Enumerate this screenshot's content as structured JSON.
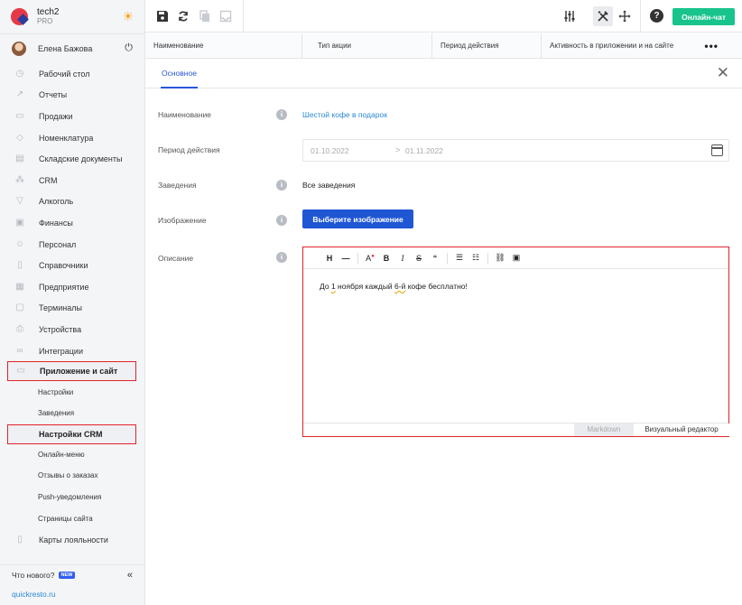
{
  "app": {
    "name": "tech2",
    "plan": "PRO"
  },
  "user": {
    "name": "Елена Бажова"
  },
  "sidebar": {
    "items": [
      {
        "label": "Рабочий стол",
        "icon": "dashboard-icon"
      },
      {
        "label": "Отчеты",
        "icon": "reports-icon"
      },
      {
        "label": "Продажи",
        "icon": "sales-icon"
      },
      {
        "label": "Номенклатура",
        "icon": "tag-icon"
      },
      {
        "label": "Складские документы",
        "icon": "warehouse-icon"
      },
      {
        "label": "CRM",
        "icon": "crm-icon"
      },
      {
        "label": "Алкоголь",
        "icon": "glass-icon"
      },
      {
        "label": "Финансы",
        "icon": "finance-icon"
      },
      {
        "label": "Персонал",
        "icon": "staff-icon"
      },
      {
        "label": "Справочники",
        "icon": "book-icon"
      },
      {
        "label": "Предприятие",
        "icon": "enterprise-icon"
      },
      {
        "label": "Терминалы",
        "icon": "terminal-icon"
      },
      {
        "label": "Устройства",
        "icon": "printer-icon"
      },
      {
        "label": "Интеграции",
        "icon": "integration-icon"
      },
      {
        "label": "Приложение и сайт",
        "icon": "app-site-icon"
      }
    ],
    "sub_items": [
      {
        "label": "Настройки"
      },
      {
        "label": "Заведения"
      },
      {
        "label": "Настройки CRM"
      },
      {
        "label": "Онлайн-меню"
      },
      {
        "label": "Отзывы о заказах"
      },
      {
        "label": "Push-уведомления"
      },
      {
        "label": "Страницы сайта"
      }
    ],
    "after_item": {
      "label": "Карты лояльности",
      "icon": "loyalty-card-icon"
    },
    "whats_new": "Что нового?",
    "new_badge": "NEW",
    "site_link": "quickresto.ru"
  },
  "topbar": {
    "chat_button": "Онлайн-чат"
  },
  "columns": [
    "Наименование",
    "Тип акции",
    "Период действия",
    "Активность в приложении и на сайте"
  ],
  "tabs": {
    "main": "Основное"
  },
  "form": {
    "name_label": "Наименование",
    "name_value": "Шестой кофе в подарок",
    "period_label": "Период действия",
    "date_from": "01.10.2022",
    "date_arrow": ">",
    "date_to": "01.11.2022",
    "venues_label": "Заведения",
    "venues_value": "Все заведения",
    "image_label": "Изображение",
    "image_button": "Выберите изображение",
    "description_label": "Описание"
  },
  "editor": {
    "content_a": "До ",
    "content_b": "1",
    "content_c": " ноября каждый ",
    "content_d": "6-й",
    "content_e": " кофе бесплатно!",
    "mode_markdown": "Markdown",
    "mode_visual": "Визуальный редактор"
  }
}
